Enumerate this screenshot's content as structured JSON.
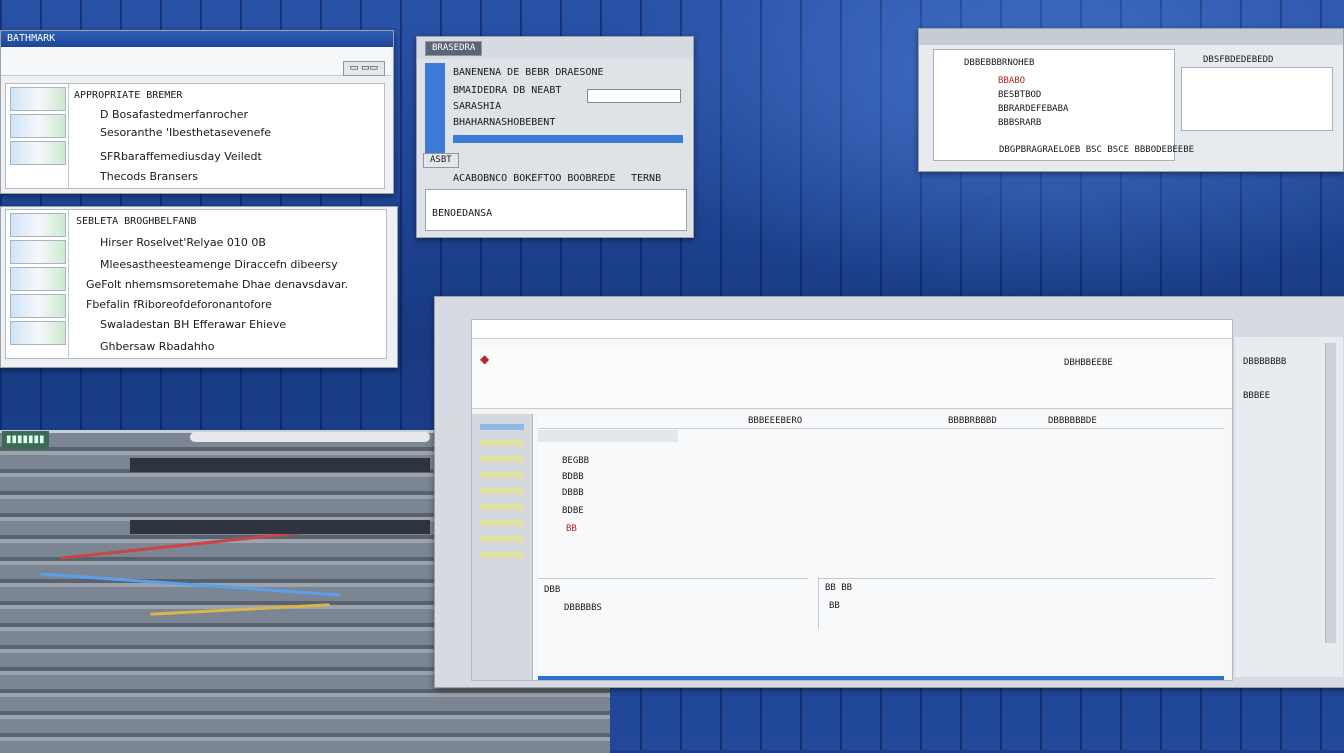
{
  "colors": {
    "desktop": "#1d3f86",
    "accent": "#2f6fd0",
    "warning_mark": "#b3262a",
    "nav_highlight": "#e3e2a0"
  },
  "win1": {
    "title": "BATHMARK",
    "header": "APPROPRIATE BREMER",
    "lines": [
      "D Bosafastedmerfanrocher",
      "Sesoranthe 'Ibesthetasevenefe",
      "SFRbaraffemediusday Veiledt",
      "Thecods Bransers"
    ]
  },
  "win2": {
    "header": "SEBLETA BROGHBELFANB",
    "lines": [
      "Hirser Roselvet'Relyae 010 0B",
      "Mleesastheesteamenge Diraccefn dibeersy",
      "GeFolt nhemsmsoretemahe Dhae denavsdavar.",
      "Fbefalin fRiboreofdeforonantofore",
      "Swaladestan BH Efferawar Ehieve",
      "Ghbersaw Rbadahho"
    ]
  },
  "win3": {
    "title": "BRASEDRA",
    "rows": [
      "BANENENA DE BEBR DRAESONE",
      "BMAIDEDRA DB NEABT",
      "SARASHIA",
      "BHAHARNASHOBEBENT"
    ],
    "button": "ASBT",
    "section": "ACABOBNCO BOKEFTOO BOOBREDE",
    "tab": "TERNB",
    "footer": "BENOEDANSA"
  },
  "win4": {
    "header": "DBBEBBBRNOHEB",
    "items": [
      "BBABO",
      "BESBTBOD",
      "BBRARDEFEBABA",
      "BBBSRARB"
    ],
    "right_label": "DBSFBDEDEBEDD",
    "footer": "DBGPBRAGRAELOEB BSC BSCE BBBODEBEEBE"
  },
  "main": {
    "tab_labels": [
      "BBBEEEBERO",
      "BBBBRBBBD",
      "DBBBBBBDE"
    ],
    "side_label": "DBHBBEEBE",
    "content_items": [
      "BEGBB",
      "BDBB",
      "DBBB",
      "BDBE",
      "BB"
    ],
    "panel_left": [
      "DBB",
      "DBBBBBS"
    ],
    "panel_right": [
      "BB BB",
      "BB"
    ],
    "right_labels": [
      "DBBBBBBB",
      "BBBEE"
    ]
  }
}
